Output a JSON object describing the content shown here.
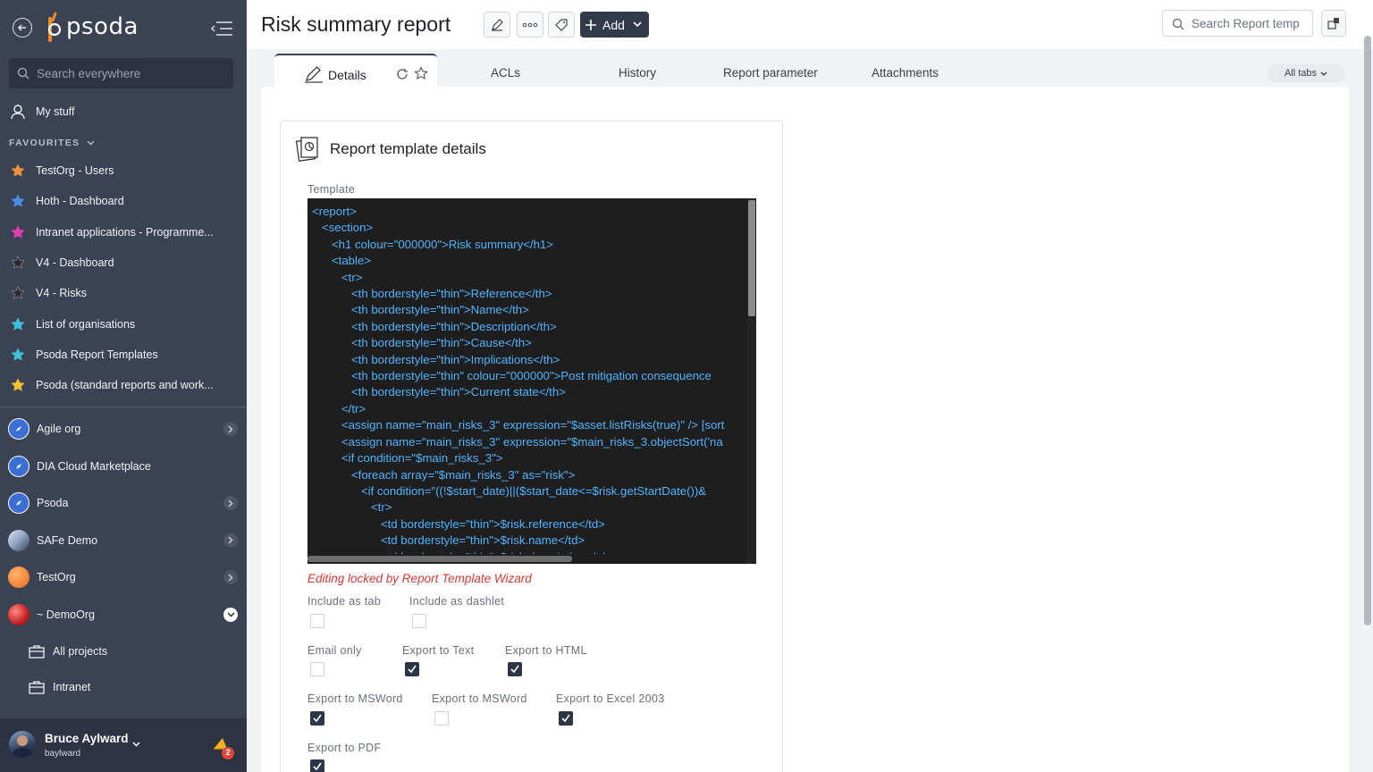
{
  "app": {
    "logo_text": "psoda"
  },
  "sidebar": {
    "search_placeholder": "Search everywhere",
    "my_stuff": "My stuff",
    "favourites_heading": "FAVOURITES",
    "favourites": [
      {
        "label": "TestOrg - Users",
        "color": "#f0913a"
      },
      {
        "label": "Hoth - Dashboard",
        "color": "#4a8ee8"
      },
      {
        "label": "Intranet applications - Programme...",
        "color": "#e23fb0"
      },
      {
        "label": "V4 - Dashboard",
        "color": "#2b2b2b"
      },
      {
        "label": "V4 - Risks",
        "color": "#2b2b2b"
      },
      {
        "label": "List of organisations",
        "color": "#3cc1d8"
      },
      {
        "label": "Psoda Report Templates",
        "color": "#3cc1d8"
      },
      {
        "label": "Psoda (standard reports and work...",
        "color": "#f2c12e"
      }
    ],
    "orgs": [
      {
        "label": "Agile org",
        "icon": "compass-icon",
        "expand": "chevron-right"
      },
      {
        "label": "DIA Cloud Marketplace",
        "icon": "compass-icon",
        "expand": ""
      },
      {
        "label": "Psoda",
        "icon": "compass-icon",
        "expand": "chevron-right"
      },
      {
        "label": "SAFe Demo",
        "icon": "mountain-icon",
        "expand": "chevron-right"
      },
      {
        "label": "TestOrg",
        "icon": "orange-globe-icon",
        "expand": "chevron-right"
      },
      {
        "label": "~ DemoOrg",
        "icon": "red-globe-icon",
        "expand": "chevron-down"
      }
    ],
    "sub_items": [
      {
        "label": "All projects",
        "icon": "briefcase-icon"
      },
      {
        "label": "Intranet",
        "icon": "briefcase-icon"
      }
    ],
    "user": {
      "name": "Bruce Aylward",
      "username": "baylward",
      "notifications": "2"
    }
  },
  "header": {
    "title": "Risk summary report",
    "add_label": "Add",
    "search_placeholder": "Search Report temp"
  },
  "tabs": {
    "active": "Details",
    "items": [
      "ACLs",
      "History",
      "Report parameter",
      "Attachments"
    ],
    "all_tabs": "All tabs"
  },
  "card": {
    "title": "Report template details",
    "template_label": "Template",
    "template_code": "<report>\n   <section>\n      <h1 colour=\"000000\">Risk summary</h1>\n      <table>\n         <tr>\n            <th borderstyle=\"thin\">Reference</th>\n            <th borderstyle=\"thin\">Name</th>\n            <th borderstyle=\"thin\">Description</th>\n            <th borderstyle=\"thin\">Cause</th>\n            <th borderstyle=\"thin\">Implications</th>\n            <th borderstyle=\"thin\" colour=\"000000\">Post mitigation consequence\n            <th borderstyle=\"thin\">Current state</th>\n         </tr>\n         <assign name=\"main_risks_3\" expression=\"$asset.listRisks(true)\" /> [sort\n         <assign name=\"main_risks_3\" expression=\"$main_risks_3.objectSort('na\n         <if condition=\"$main_risks_3\">\n            <foreach array=\"$main_risks_3\" as=\"risk\">\n               <if condition=\"((!$start_date)||($start_date<=$risk.getStartDate())&\n                  <tr>\n                     <td borderstyle=\"thin\">$risk.reference</td>\n                     <td borderstyle=\"thin\">$risk.name</td>\n                     <td borderstyle=\"thin\">$risk.description</td>",
    "lock_note": "Editing locked by Report Template Wizard",
    "options": [
      {
        "label": "Include as tab",
        "checked": false
      },
      {
        "label": "Include as dashlet",
        "checked": false
      },
      {
        "label": "Email only",
        "checked": false
      },
      {
        "label": "Export to Text",
        "checked": true
      },
      {
        "label": "Export to HTML",
        "checked": true
      },
      {
        "label": "Export to MSWord",
        "checked": true
      },
      {
        "label": "Export to MSWord",
        "checked": false
      },
      {
        "label": "Export to Excel 2003",
        "checked": true
      },
      {
        "label": "Export to PDF",
        "checked": true
      }
    ]
  }
}
